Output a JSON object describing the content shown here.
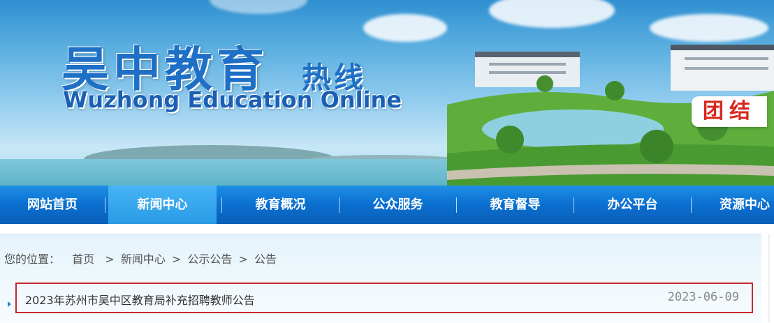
{
  "banner": {
    "title_cn": "吴中教育",
    "title_cn_sub": "热线",
    "title_en": "Wuzhong Education Online",
    "slogan": "团结"
  },
  "nav": {
    "items": [
      {
        "label": "网站首页",
        "active": false
      },
      {
        "label": "新闻中心",
        "active": true
      },
      {
        "label": "教育概况",
        "active": false
      },
      {
        "label": "公众服务",
        "active": false
      },
      {
        "label": "教育督导",
        "active": false
      },
      {
        "label": "办公平台",
        "active": false
      },
      {
        "label": "资源中心",
        "active": false
      }
    ]
  },
  "breadcrumb": {
    "prefix": "您的位置：",
    "home": "首页",
    "sep1": ">",
    "level1": "新闻中心",
    "sep2": ">",
    "level2": "公示公告",
    "sep3": ">",
    "level3": "公告"
  },
  "list": {
    "items": [
      {
        "title": "2023年苏州市吴中区教育局补充招聘教师公告",
        "date": "2023-06-09"
      }
    ]
  },
  "colors": {
    "nav": "#0b6fd0",
    "nav_active": "#2a9ae6",
    "highlight_border": "#c8282f",
    "logo": "#1e6fc6"
  }
}
